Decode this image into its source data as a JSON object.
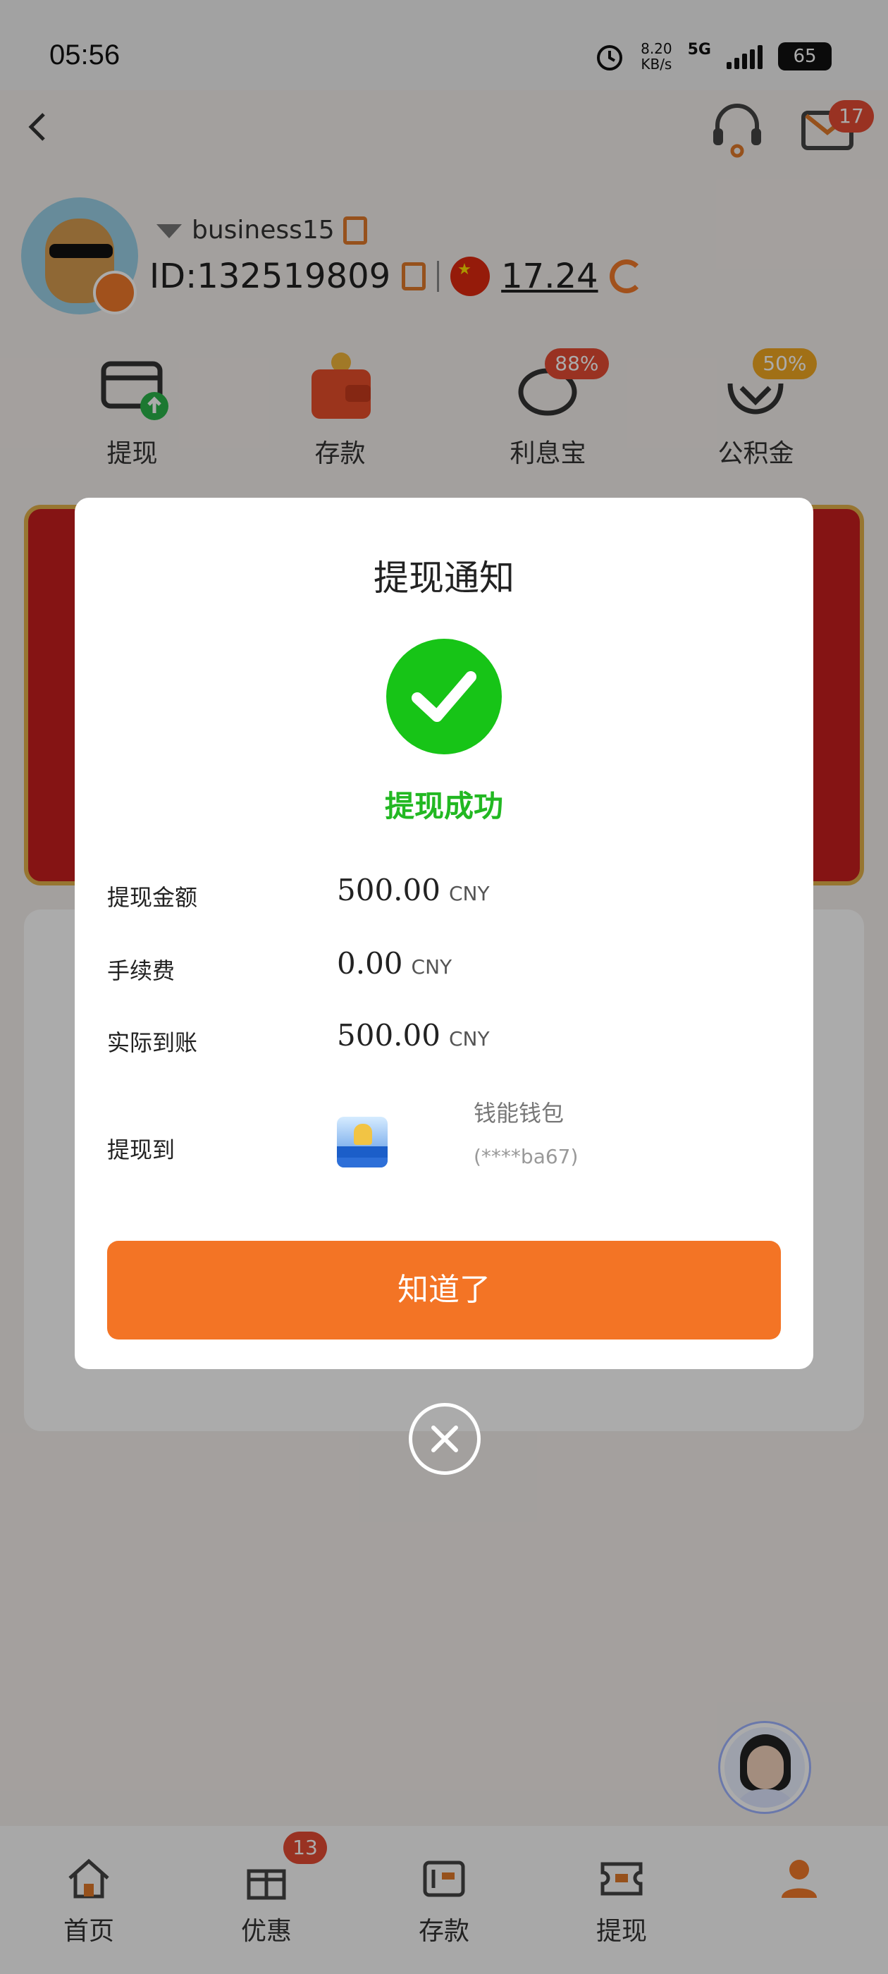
{
  "status_bar": {
    "time": "05:56",
    "net_speed_value": "8.20",
    "net_speed_unit": "KB/s",
    "network": "5G",
    "battery": "65"
  },
  "header": {
    "message_badge": "17"
  },
  "profile": {
    "username": "business15",
    "user_id": "ID:132519809",
    "balance": "17.24"
  },
  "quick_actions": [
    {
      "label": "提现",
      "badge": ""
    },
    {
      "label": "存款",
      "badge": ""
    },
    {
      "label": "利息宝",
      "badge": "88%"
    },
    {
      "label": "公积金",
      "badge": "50%"
    }
  ],
  "modal": {
    "title": "提现通知",
    "success_text": "提现成功",
    "rows": [
      {
        "label": "提现金额",
        "value": "500.00",
        "unit": "CNY"
      },
      {
        "label": "手续费",
        "value": "0.00",
        "unit": "CNY"
      },
      {
        "label": "实际到账",
        "value": "500.00",
        "unit": "CNY"
      }
    ],
    "destination_label": "提现到",
    "wallet_name": "钱能钱包",
    "wallet_account": "(****ba67)",
    "confirm_button": "知道了"
  },
  "bottom_nav": [
    {
      "label": "首页",
      "badge": ""
    },
    {
      "label": "优惠",
      "badge": "13"
    },
    {
      "label": "存款",
      "badge": ""
    },
    {
      "label": "提现",
      "badge": ""
    },
    {
      "label": "",
      "badge": ""
    }
  ],
  "colors": {
    "accent": "#f37425",
    "success": "#17c417",
    "badge": "#e44b33"
  }
}
